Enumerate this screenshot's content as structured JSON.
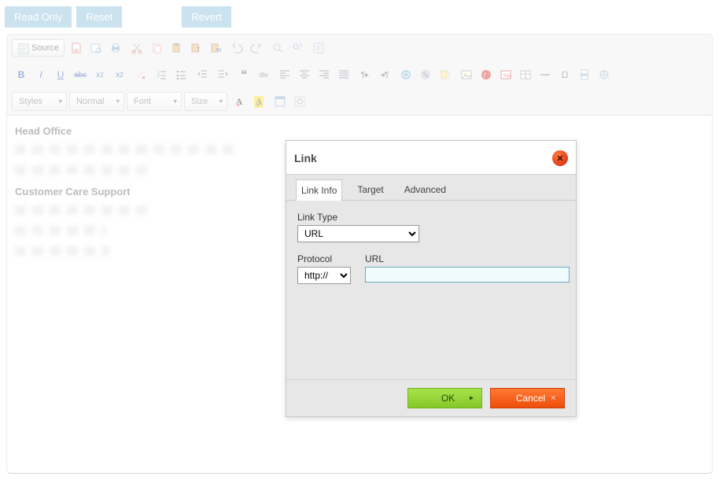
{
  "topbar": {
    "read_only": "Read Only",
    "reset": "Reset",
    "revert": "Revert"
  },
  "toolbar": {
    "source": "Source",
    "styles": "Styles",
    "format": "Normal",
    "font": "Font",
    "size": "Size"
  },
  "content": {
    "heading1": "Head Office",
    "heading2": "Customer Care Support"
  },
  "dialog": {
    "title": "Link",
    "tabs": {
      "link_info": "Link Info",
      "target": "Target",
      "advanced": "Advanced"
    },
    "link_type_label": "Link Type",
    "link_type_value": "URL",
    "protocol_label": "Protocol",
    "protocol_value": "http://",
    "url_label": "URL",
    "url_value": "",
    "ok": "OK",
    "cancel": "Cancel"
  }
}
